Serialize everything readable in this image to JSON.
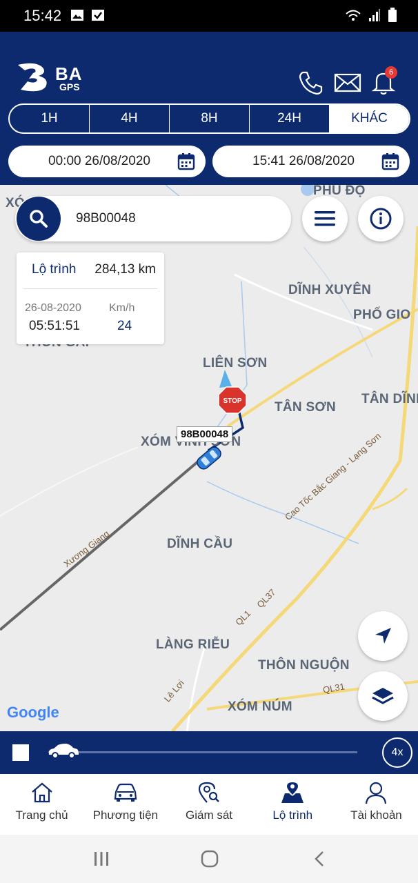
{
  "status_bar": {
    "time": "15:42"
  },
  "header": {
    "brand": "BA",
    "brand_sub": "GPS",
    "notification_count": "6",
    "colors": {
      "primary": "#0d2a6e",
      "badge": "#e53935"
    }
  },
  "time_range": {
    "options": [
      "1H",
      "4H",
      "8H",
      "24H",
      "KHÁC"
    ],
    "selected": "KHÁC"
  },
  "dates": {
    "start": "00:00 26/08/2020",
    "end": "15:41 26/08/2020"
  },
  "search": {
    "value": "98B00048"
  },
  "trip_info": {
    "distance_label": "Lộ trình",
    "distance_value": "284,13 km",
    "date": "26-08-2020",
    "time": "05:51:51",
    "speed_label": "Km/h",
    "speed_value": "24"
  },
  "map": {
    "places": [
      "PHÚ ĐỘ",
      "DĨNH XUYÊN",
      "PHỐ GIO",
      "THÔN GAI",
      "LIÊN SƠN",
      "TÂN SƠN",
      "TÂN DĨNH",
      "XÓM VINH SƠN",
      "DĨNH CẦU",
      "LÀNG RIỄU",
      "THÔN NGUỘN",
      "XÓM NÚM",
      "XÓ"
    ],
    "roads": [
      "Xương Giang",
      "Cao Tốc Bắc Giang - Lạng Sơn",
      "Lê Lợi",
      "QL1",
      "QL37",
      "QL31"
    ],
    "vehicle_plate": "98B00048",
    "stop_sign": "STOP",
    "attribution": "Google"
  },
  "playback": {
    "speed": "4x",
    "progress": 0.0
  },
  "bottom_nav": [
    {
      "label": "Trang chủ",
      "icon": "home-icon",
      "active": false
    },
    {
      "label": "Phương tiện",
      "icon": "car-icon",
      "active": false
    },
    {
      "label": "Giám sát",
      "icon": "location-search-icon",
      "active": false
    },
    {
      "label": "Lộ trình",
      "icon": "route-map-icon",
      "active": true
    },
    {
      "label": "Tài khoản",
      "icon": "user-icon",
      "active": false
    }
  ]
}
